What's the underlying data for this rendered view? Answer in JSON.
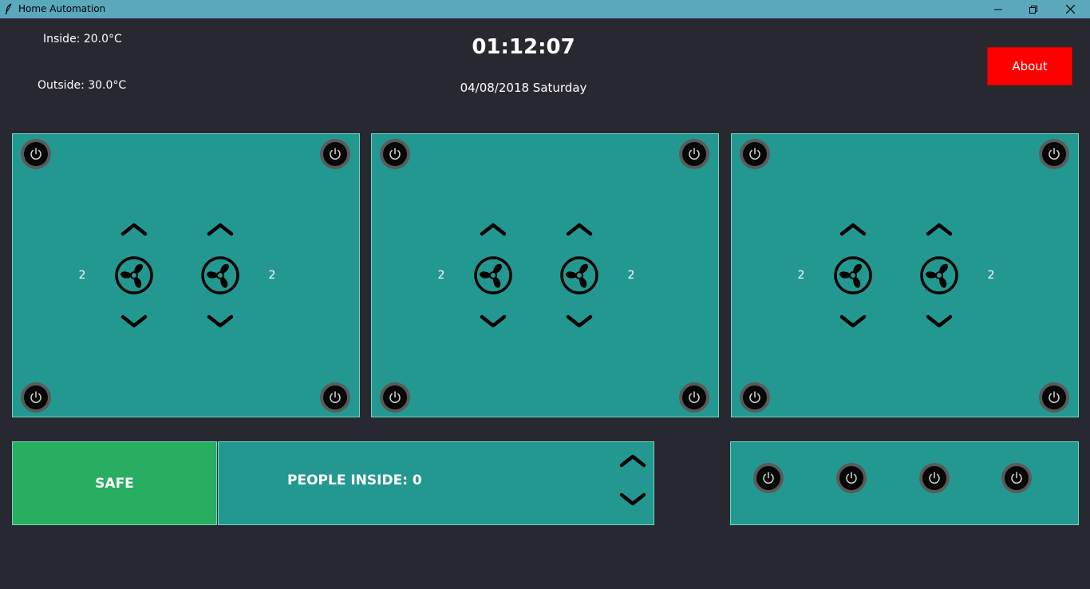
{
  "window": {
    "title": "Home Automation"
  },
  "header": {
    "inside_temp": "Inside: 20.0°C",
    "outside_temp": "Outside: 30.0°C",
    "time": "01:12:07",
    "date": "04/08/2018  Saturday",
    "about_label": "About"
  },
  "rooms": [
    {
      "fan_left_level": "2",
      "fan_right_level": "2"
    },
    {
      "fan_left_level": "2",
      "fan_right_level": "2"
    },
    {
      "fan_left_level": "2",
      "fan_right_level": "2"
    }
  ],
  "status": {
    "safe_label": "SAFE",
    "people_label": "PEOPLE INSIDE: 0"
  },
  "colors": {
    "background": "#282830",
    "panel": "#239890",
    "safe": "#27ae60",
    "about": "#ff0000",
    "titlebar": "#5ba8bd"
  },
  "icons": [
    "feather-icon",
    "minimize-icon",
    "maximize-icon",
    "close-icon",
    "power-icon",
    "fan-icon",
    "chevron-up-icon",
    "chevron-down-icon"
  ]
}
